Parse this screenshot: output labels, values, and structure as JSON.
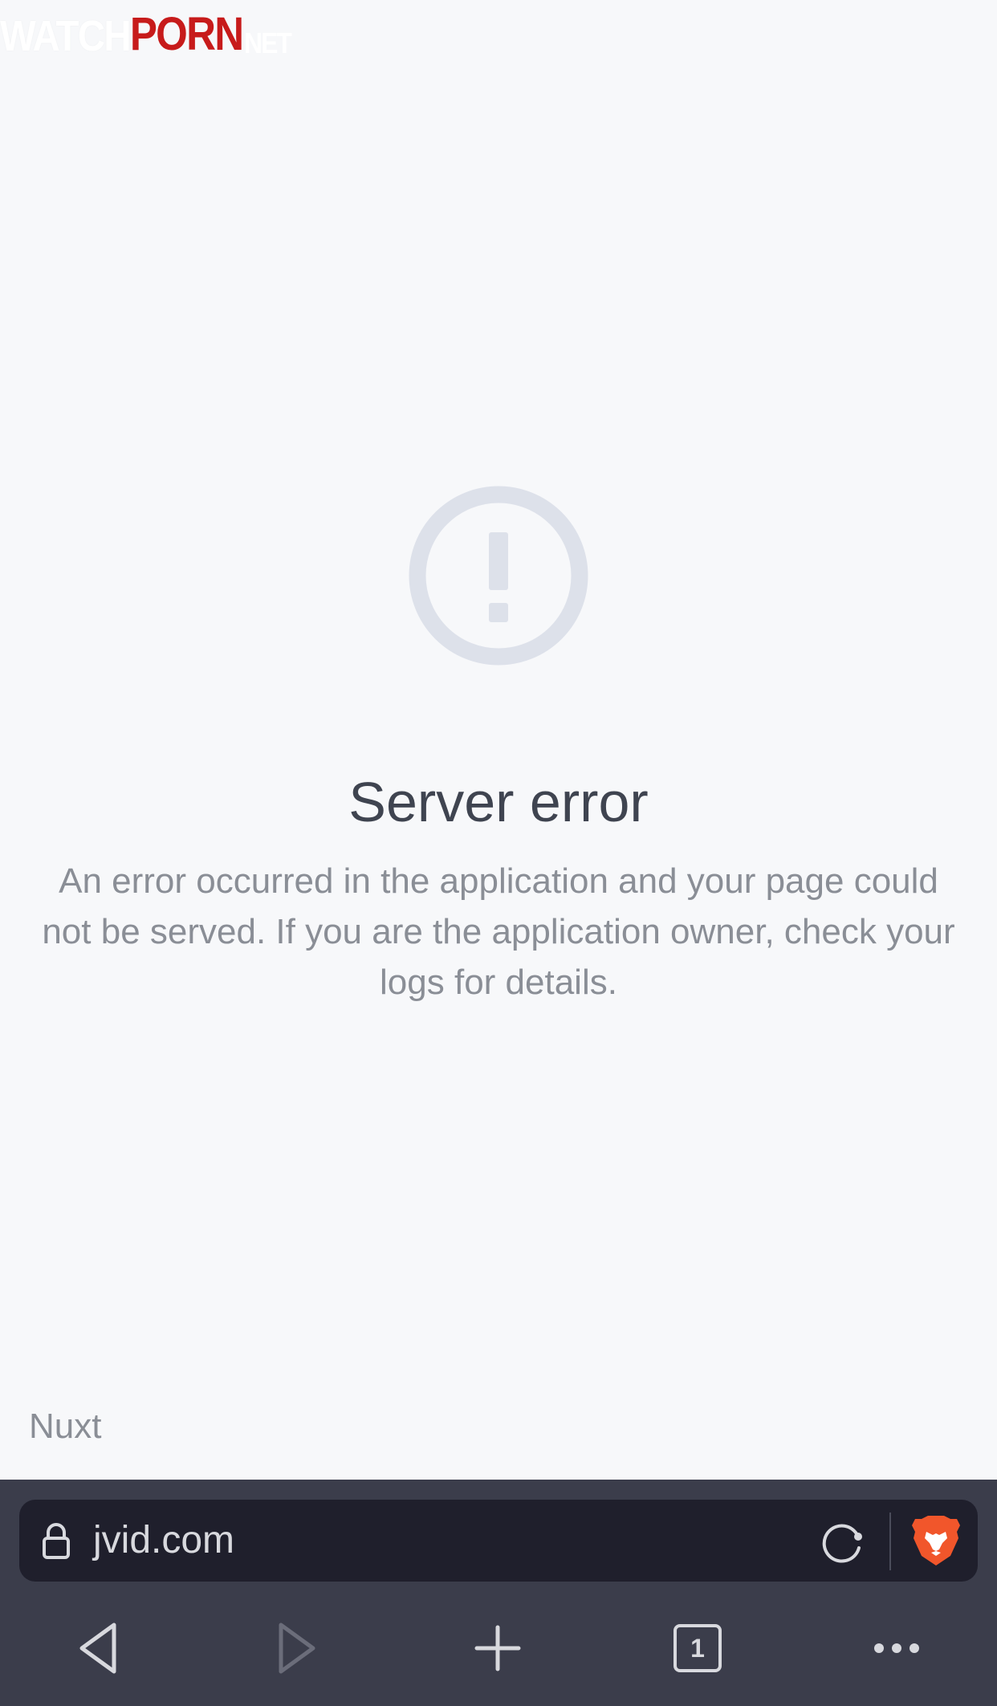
{
  "watermark": {
    "part1": "WATCH",
    "part2": "PORN",
    "part3": "NET"
  },
  "error": {
    "icon": "exclamation-circle-icon",
    "title": "Server error",
    "message": "An error occurred in the application and your page could not be served. If you are the application owner, check your logs for details."
  },
  "framework": {
    "label": "Nuxt"
  },
  "browser": {
    "url": "jvid.com",
    "tabs_count": "1",
    "icons": {
      "lock": "lock-icon",
      "reload": "reload-icon",
      "shields": "brave-lion-icon",
      "back": "back-arrow-icon",
      "forward": "forward-arrow-icon",
      "new_tab": "plus-icon",
      "tabs": "tabs-icon",
      "menu": "more-dots-icon"
    }
  },
  "colors": {
    "page_bg": "#f7f8fa",
    "icon_circle": "#dde1ea",
    "title": "#3f4450",
    "message": "#8a8e96",
    "browser_bar": "#3b3d4b",
    "url_field": "#1f1f2c",
    "brave_orange": "#f1562b"
  }
}
